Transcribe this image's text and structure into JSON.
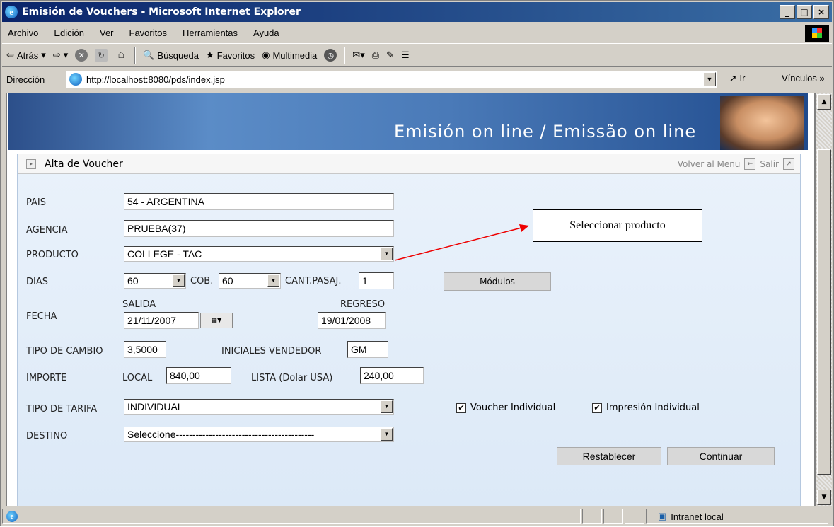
{
  "window": {
    "title": "Emisión de Vouchers - Microsoft Internet Explorer",
    "minimize": "_",
    "maximize": "□",
    "close": "×"
  },
  "menu": [
    "Archivo",
    "Edición",
    "Ver",
    "Favoritos",
    "Herramientas",
    "Ayuda"
  ],
  "toolbar": {
    "back": "Atrás",
    "search": "Búsqueda",
    "favorites": "Favoritos",
    "multimedia": "Multimedia"
  },
  "address": {
    "label": "Dirección",
    "url": "http://localhost:8080/pds/index.jsp",
    "go": "Ir",
    "links": "Vínculos"
  },
  "banner": {
    "title": "Emisión on line / Emissão on line"
  },
  "panel": {
    "title": "Alta de Voucher",
    "back_menu": "Volver al Menu",
    "exit": "Salir"
  },
  "form": {
    "pais_label": "PAIS",
    "pais_value": "54 - ARGENTINA",
    "agencia_label": "AGENCIA",
    "agencia_value": "PRUEBA(37)",
    "producto_label": "PRODUCTO",
    "producto_value": "COLLEGE - TAC",
    "dias_label": "DIAS",
    "dias_value": "60",
    "cob_label": "COB.",
    "cob_value": "60",
    "cant_label": "CANT.PASAJ.",
    "cant_value": "1",
    "modulos_button": "Módulos",
    "fecha_label": "FECHA",
    "salida_label": "SALIDA",
    "salida_value": "21/11/2007",
    "regreso_label": "REGRESO",
    "regreso_value": "19/01/2008",
    "tipo_cambio_label": "TIPO DE CAMBIO",
    "tipo_cambio_value": "3,5000",
    "iniciales_label": "INICIALES VENDEDOR",
    "iniciales_value": "GM",
    "importe_label": "IMPORTE",
    "local_label": "LOCAL",
    "local_value": "840,00",
    "lista_label": "LISTA (Dolar USA)",
    "lista_value": "240,00",
    "tarifa_label": "TIPO DE TARIFA",
    "tarifa_value": "INDIVIDUAL",
    "voucher_ind_label": "Voucher Individual",
    "impresion_ind_label": "Impresión Individual",
    "destino_label": "DESTINO",
    "destino_value": "Seleccione------------------------------------------",
    "restablecer_button": "Restablecer",
    "continuar_button": "Continuar"
  },
  "callout": {
    "text": "Seleccionar producto"
  },
  "status": {
    "zone": "Intranet local"
  }
}
